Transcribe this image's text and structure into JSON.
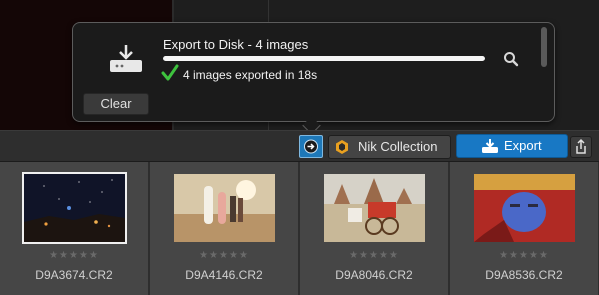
{
  "popover": {
    "title": "Export to Disk - 4 images",
    "progress": 1.0,
    "status": "4 images exported in 18s",
    "clear_label": "Clear"
  },
  "toolbar": {
    "nik_label": "Nik Collection",
    "export_label": "Export"
  },
  "filmstrip": {
    "items": [
      {
        "filename": "D9A3674.CR2",
        "rating": "★★★★★",
        "selected": true
      },
      {
        "filename": "D9A4146.CR2",
        "rating": "★★★★★",
        "selected": false
      },
      {
        "filename": "D9A8046.CR2",
        "rating": "★★★★★",
        "selected": false
      },
      {
        "filename": "D9A8536.CR2",
        "rating": "★★★★★",
        "selected": false
      }
    ]
  },
  "icons": {
    "disk": "download-to-disk-icon",
    "check": "checkmark-icon",
    "search": "magnifier-icon",
    "toggle": "arrow-circle-icon",
    "nik": "nik-aperture-icon",
    "export": "export-download-icon",
    "share": "share-icon"
  },
  "colors": {
    "accent": "#1878c4",
    "success": "#3ec23e"
  }
}
